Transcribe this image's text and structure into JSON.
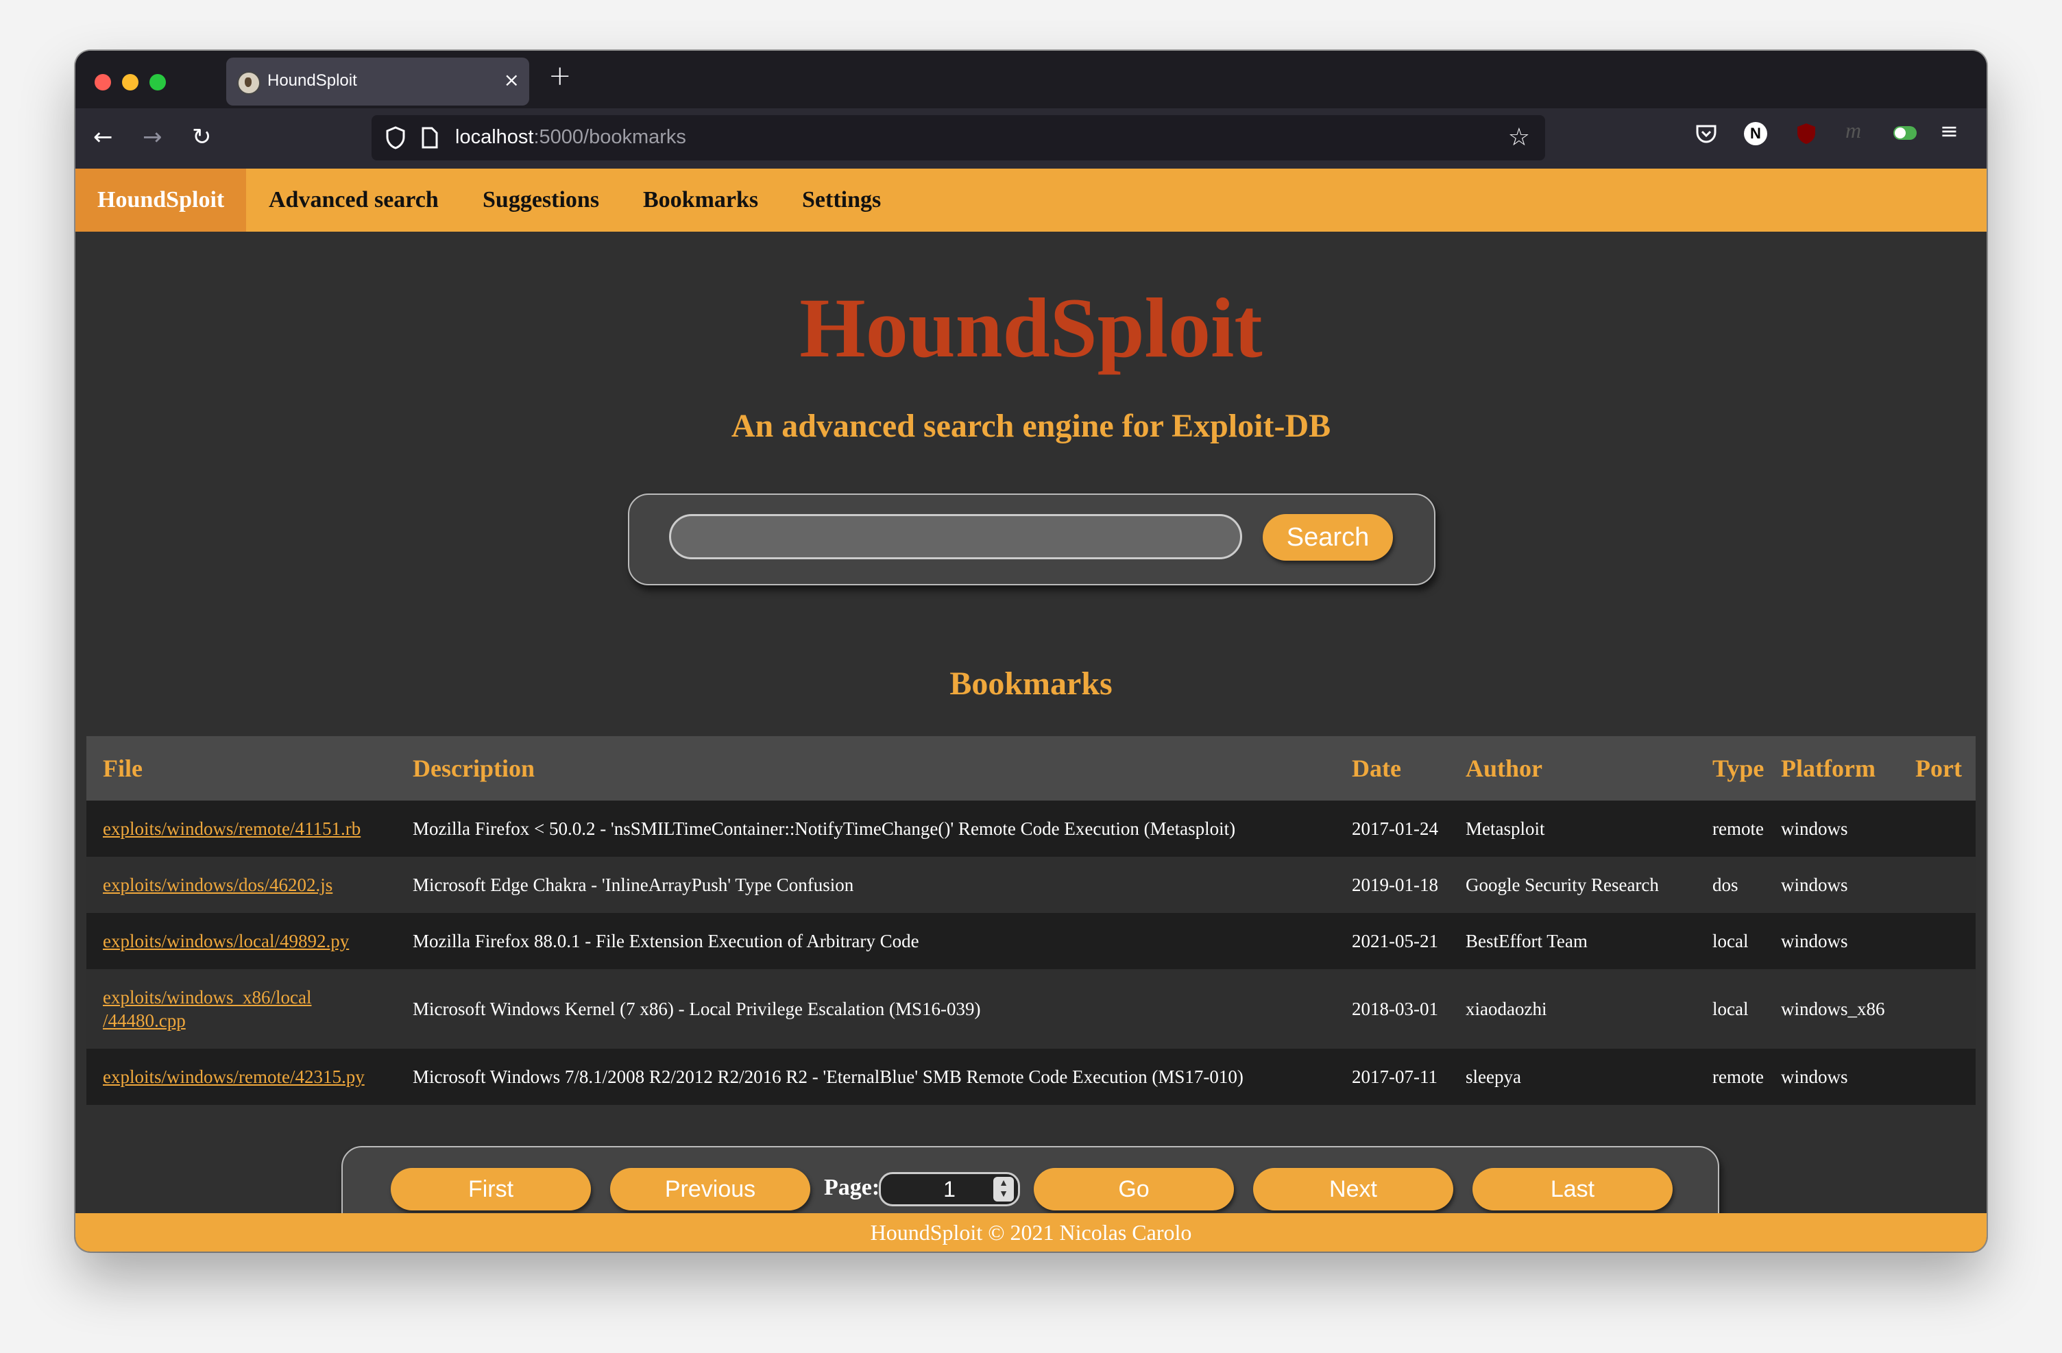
{
  "browser": {
    "tab_title": "HoundSploit",
    "tab_close": "×",
    "new_tab": "+",
    "url_host": "localhost",
    "url_rest": ":5000/bookmarks"
  },
  "site_nav": {
    "brand": "HoundSploit",
    "items": [
      "Advanced search",
      "Suggestions",
      "Bookmarks",
      "Settings"
    ]
  },
  "hero": {
    "title": "HoundSploit",
    "subtitle": "An advanced search engine for Exploit-DB"
  },
  "search": {
    "value": "",
    "button": "Search"
  },
  "bookmarks": {
    "title": "Bookmarks",
    "columns": [
      "File",
      "Description",
      "Date",
      "Author",
      "Type",
      "Platform",
      "Port"
    ],
    "rows": [
      {
        "file": "exploits/windows/remote/41151.rb",
        "description": "Mozilla Firefox < 50.0.2 - 'nsSMILTimeContainer::NotifyTimeChange()' Remote Code Execution (Metasploit)",
        "date": "2017-01-24",
        "author": "Metasploit",
        "type": "remote",
        "platform": "windows",
        "port": ""
      },
      {
        "file": "exploits/windows/dos/46202.js",
        "description": "Microsoft Edge Chakra - 'InlineArrayPush' Type Confusion",
        "date": "2019-01-18",
        "author": "Google Security Research",
        "type": "dos",
        "platform": "windows",
        "port": ""
      },
      {
        "file": "exploits/windows/local/49892.py",
        "description": "Mozilla Firefox 88.0.1 - File Extension Execution of Arbitrary Code",
        "date": "2021-05-21",
        "author": "BestEffort Team",
        "type": "local",
        "platform": "windows",
        "port": ""
      },
      {
        "file": "exploits/windows_x86/local/44480.cpp",
        "file_line1": "exploits/windows_x86/local",
        "file_line2": "/44480.cpp",
        "description": "Microsoft Windows Kernel (7 x86) - Local Privilege Escalation (MS16-039)",
        "date": "2018-03-01",
        "author": "xiaodaozhi",
        "type": "local",
        "platform": "windows_x86",
        "port": ""
      },
      {
        "file": "exploits/windows/remote/42315.py",
        "description": "Microsoft Windows 7/8.1/2008 R2/2012 R2/2016 R2 - 'EternalBlue' SMB Remote Code Execution (MS17-010)",
        "date": "2017-07-11",
        "author": "sleepya",
        "type": "remote",
        "platform": "windows",
        "port": ""
      }
    ]
  },
  "pagination": {
    "first": "First",
    "previous": "Previous",
    "page_label": "Page:",
    "page_value": "1",
    "go": "Go",
    "next": "Next",
    "last": "Last"
  },
  "footer": {
    "text": "HoundSploit © 2021 Nicolas Carolo"
  },
  "colors": {
    "accent": "#f0a83c",
    "title_red": "#c0401a",
    "background": "#303030"
  }
}
